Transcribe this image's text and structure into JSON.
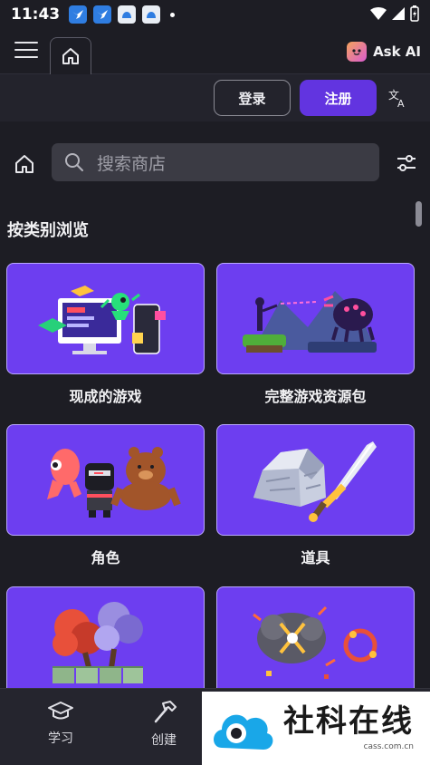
{
  "status_bar": {
    "time": "11:43"
  },
  "app_bar": {
    "ask_ai_label": "Ask AI"
  },
  "auth": {
    "login_label": "登录",
    "signup_label": "注册"
  },
  "search": {
    "placeholder": "搜索商店"
  },
  "section": {
    "title": "按类别浏览"
  },
  "categories": [
    {
      "label": "现成的游戏"
    },
    {
      "label": "完整游戏资源包"
    },
    {
      "label": "角色"
    },
    {
      "label": "道具"
    }
  ],
  "bottom_nav": {
    "learn_label": "学习",
    "create_label": "创建"
  },
  "watermark": {
    "text": "社科在线",
    "sub": "cass.com.cn"
  },
  "colors": {
    "background": "#1d1d24",
    "accent": "#6234e0",
    "card_bg": "#6d3ef0"
  }
}
